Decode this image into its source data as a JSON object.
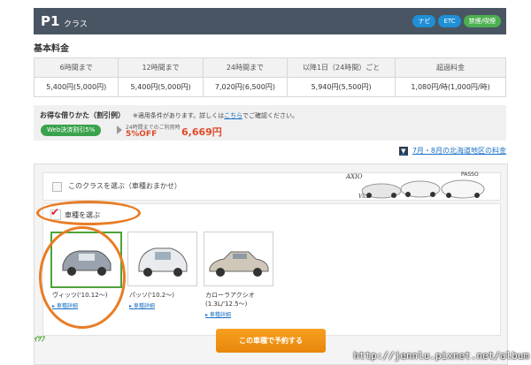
{
  "header": {
    "title": "P1",
    "subtitle": "クラス",
    "tags": {
      "navi": "ナビ",
      "etc": "ETC",
      "smoke": "禁煙/喫煙"
    }
  },
  "base_fee_title": "基本料金",
  "price_table": {
    "headers": [
      "6時間まで",
      "12時間まで",
      "24時間まで",
      "以降1日（24時間）ごと",
      "超過料金"
    ],
    "values": [
      "5,400円(5,000円)",
      "5,400円(5,000円)",
      "7,020円(6,500円)",
      "5,940円(5,500円)",
      "1,080円/時(1,000円/時)"
    ]
  },
  "discount": {
    "heading": "お得な借りかた（割引例）",
    "note_prefix": "※適用条件があります。詳しくは",
    "note_link": "こちら",
    "note_suffix": "でご確認ください。",
    "badge": "Web決済割引5%",
    "sub": "24時間までのご利用時",
    "off": "5%OFF",
    "price": "6,669円"
  },
  "hokkaido_link": "7月・8月の北海道地区の料金",
  "option_class": {
    "label": "このクラスを選ぶ（車種おまかせ）",
    "logos": {
      "axio": "AXIO",
      "passo": "PASSO",
      "vitz": "Vitz"
    }
  },
  "option_model": {
    "label": "車種を選ぶ"
  },
  "cars": [
    {
      "name": "ヴィッツ('10.12〜)",
      "detail": "車種詳細",
      "color": "#9aa3ad"
    },
    {
      "name": "パッソ('10.2〜)",
      "detail": "車種詳細",
      "color": "#e9ebee"
    },
    {
      "name": "カローラアクシオ",
      "name2": "(1.3L/'12.5〜)",
      "detail": "車種詳細",
      "color": "#cfc8b8"
    }
  ],
  "reserve_button": "この車種で予約する",
  "footer_logo": "ｲﾂﾌ",
  "watermark": "http://jennlu.pixnet.net/album",
  "colors": {
    "header": "#4a5563",
    "accent": "#e04a2a",
    "orange": "#e87d26",
    "link": "#1a6fc4"
  }
}
